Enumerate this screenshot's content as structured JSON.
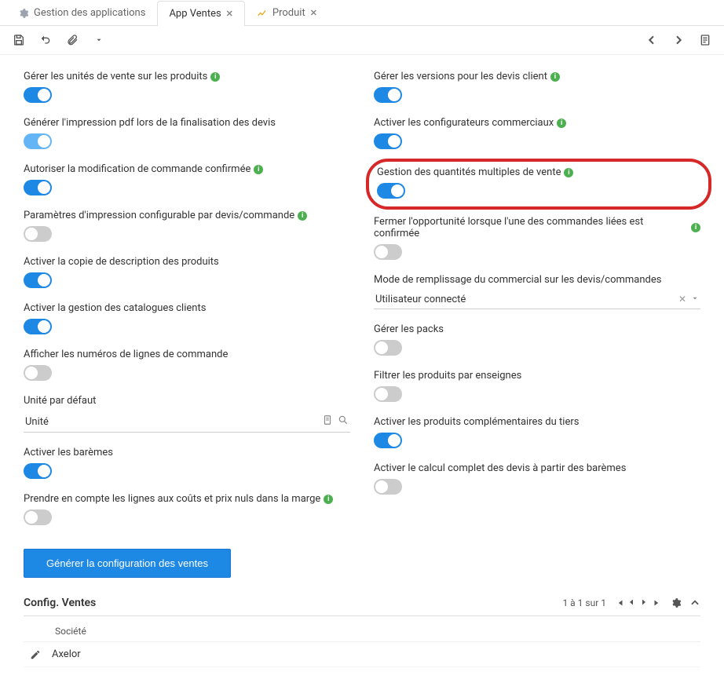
{
  "tabs": [
    {
      "label": "Gestion des applications",
      "closable": false,
      "active": false
    },
    {
      "label": "App Ventes",
      "closable": true,
      "active": true
    },
    {
      "label": "Produit",
      "closable": true,
      "active": false
    }
  ],
  "left_fields": {
    "units_label": "Gérer les unités de vente sur les produits",
    "pdf_label": "Générer l'impression pdf lors de la finalisation des devis",
    "modify_label": "Autoriser la modification de commande confirmée",
    "print_params_label": "Paramètres d'impression configurable par devis/commande",
    "copy_desc_label": "Activer la copie de description des produits",
    "catalog_label": "Activer la gestion des catalogues clients",
    "line_num_label": "Afficher les numéros de lignes de commande",
    "default_unit_label": "Unité par défaut",
    "default_unit_value": "Unité",
    "scales_label": "Activer les barèmes",
    "margin_label": "Prendre en compte les lignes aux coûts et prix nuls dans la marge"
  },
  "right_fields": {
    "versions_label": "Gérer les versions pour les devis client",
    "configurators_label": "Activer les configurateurs commerciaux",
    "multi_qty_label": "Gestion des quantités multiples de vente",
    "close_opp_label": "Fermer l'opportunité lorsque l'une des commandes liées est confirmée",
    "fill_mode_label": "Mode de remplissage du commercial sur les devis/commandes",
    "fill_mode_value": "Utilisateur connecté",
    "packs_label": "Gérer les packs",
    "filter_brands_label": "Filtrer les produits par enseignes",
    "compl_products_label": "Activer les produits complémentaires du tiers",
    "full_calc_label": "Activer le calcul complet des devis à partir des barèmes"
  },
  "button_label": "Générer la configuration des ventes",
  "section": {
    "title": "Config. Ventes",
    "paging": "1 à 1 sur 1",
    "col_header": "Société",
    "row_value": "Axelor"
  }
}
